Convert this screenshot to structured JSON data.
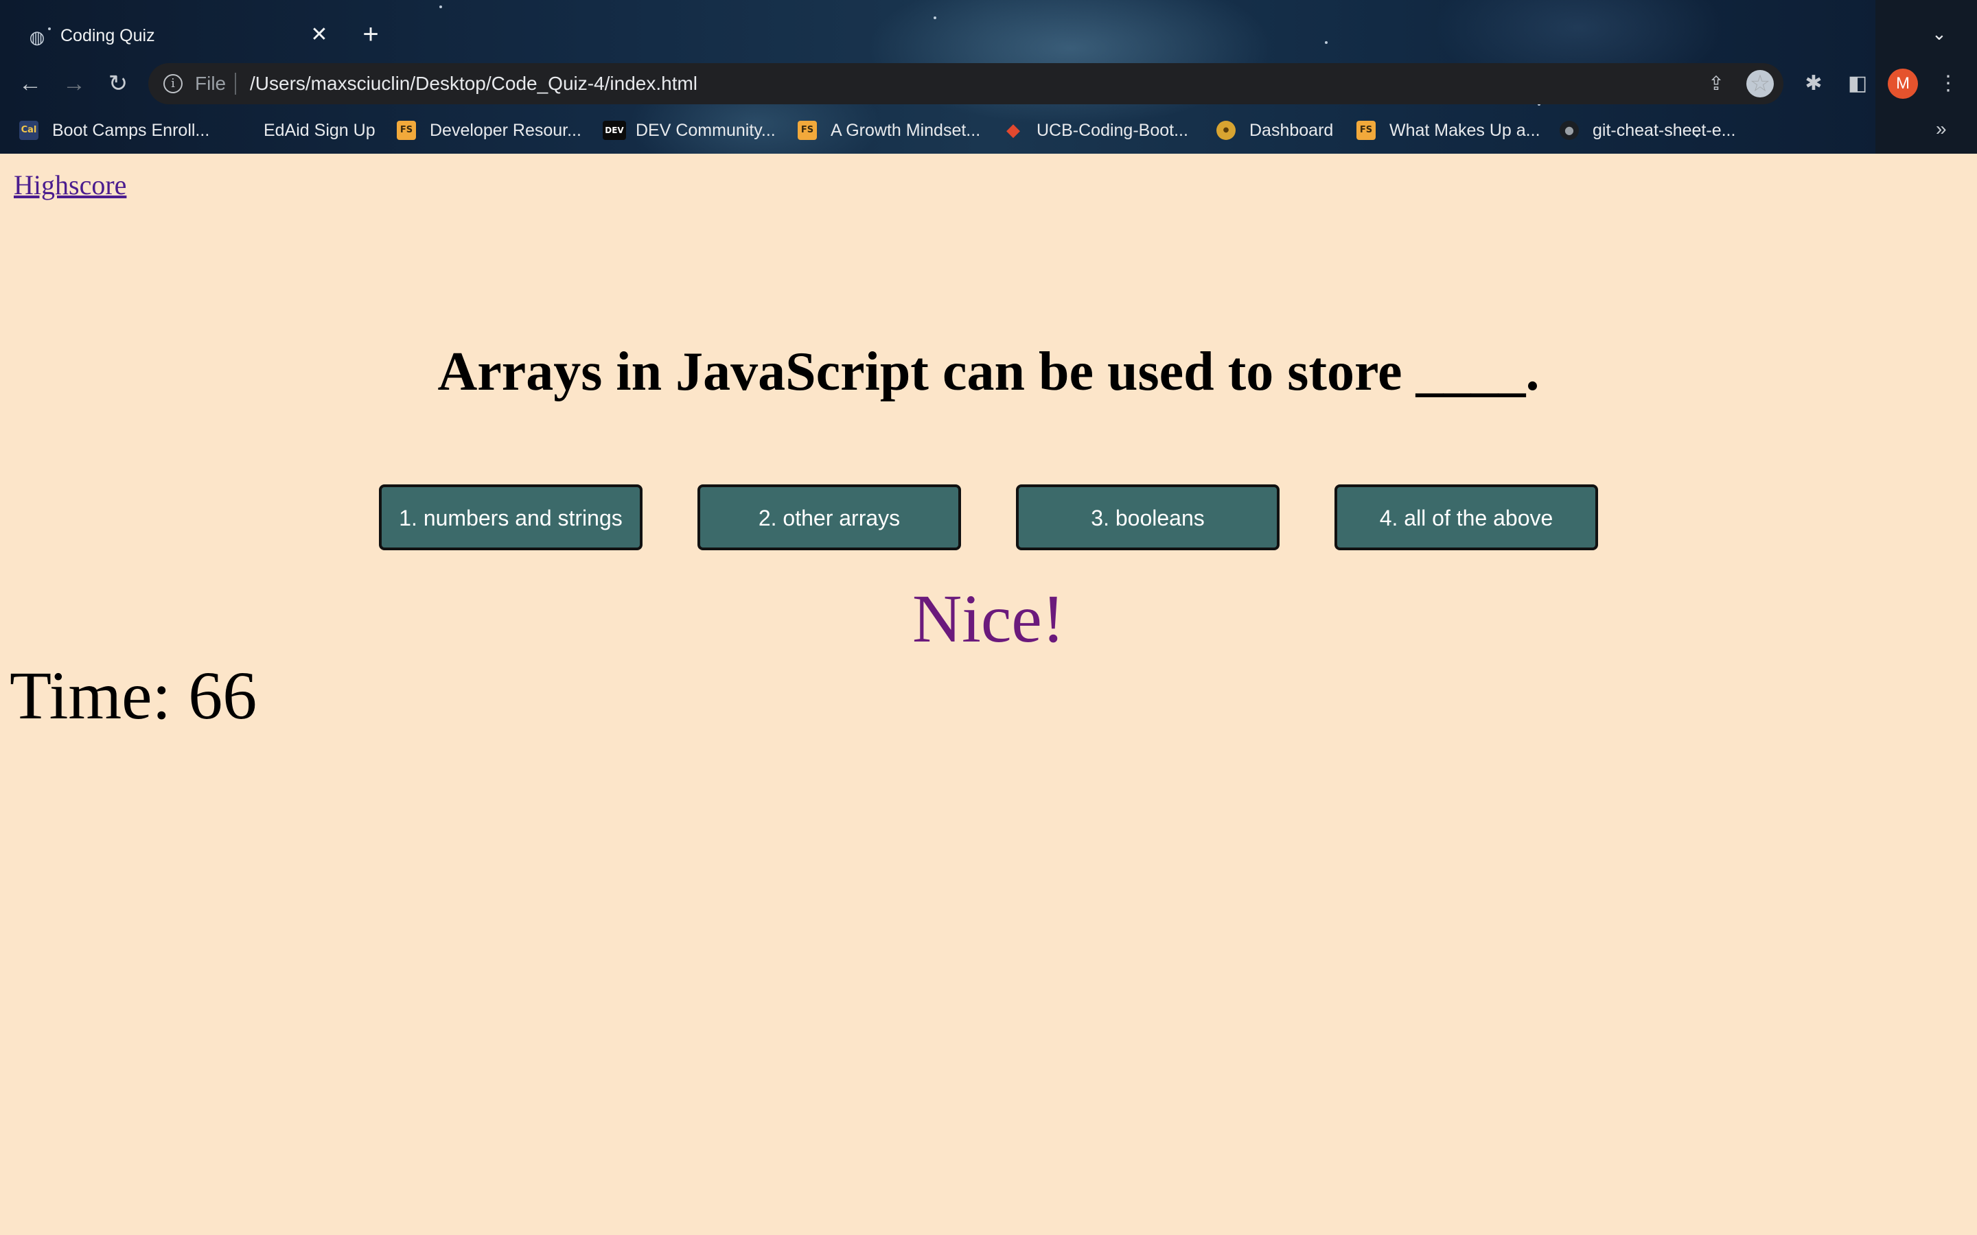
{
  "browser": {
    "tab": {
      "title": "Coding Quiz"
    },
    "address": {
      "scheme": "File",
      "url": "/Users/maxsciuclin/Desktop/Code_Quiz-4/index.html"
    },
    "profile_initial": "M",
    "bookmarks": [
      {
        "label": "Boot Camps Enroll...",
        "icon": "cal-icon"
      },
      {
        "label": "EdAid Sign Up",
        "icon": "none"
      },
      {
        "label": "Developer Resour...",
        "icon": "fs-icon"
      },
      {
        "label": "DEV Community...",
        "icon": "dev-icon"
      },
      {
        "label": "A Growth Mindset...",
        "icon": "fs-icon"
      },
      {
        "label": "UCB-Coding-Boot...",
        "icon": "gitlab-icon"
      },
      {
        "label": "Dashboard",
        "icon": "badge-icon"
      },
      {
        "label": "What Makes Up a...",
        "icon": "fs-icon"
      },
      {
        "label": "git-cheat-sheet-e...",
        "icon": "github-icon"
      }
    ]
  },
  "page": {
    "highscore_link": "Highscore",
    "question": "Arrays in JavaScript can be used to store ____.",
    "choices": [
      "1. numbers and strings",
      "2. other arrays",
      "3. booleans",
      "4. all of the above"
    ],
    "feedback": "Nice!",
    "timer": "Time: 66"
  },
  "colors": {
    "page_background": "#fce5c9",
    "button_background": "#3c6a6a",
    "feedback_text": "#6b1a7c",
    "link": "#4b1d8f"
  }
}
